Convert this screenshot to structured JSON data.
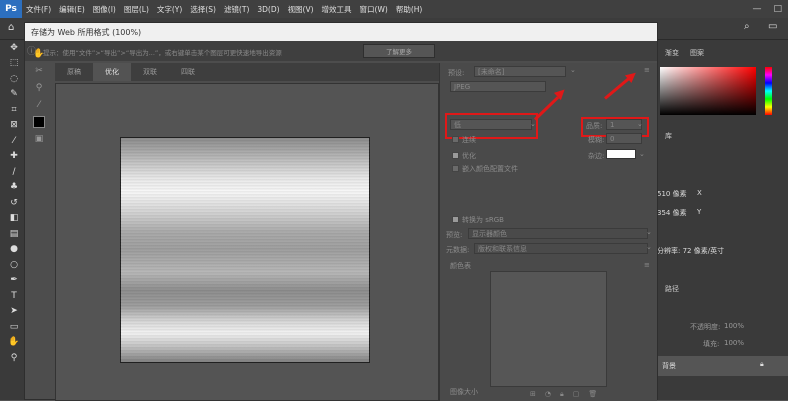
{
  "menubar": {
    "logo": "Ps",
    "items": [
      "文件(F)",
      "编辑(E)",
      "图像(I)",
      "图层(L)",
      "文字(Y)",
      "选择(S)",
      "滤镜(T)",
      "3D(D)",
      "视图(V)",
      "增效工具",
      "窗口(W)",
      "帮助(H)"
    ],
    "minimize": "—",
    "maximize": "□"
  },
  "dialog": {
    "title": "存储为 Web 所用格式 (100%)",
    "hint": "提示：使用“文件”>“导出”>“导出为...”，或右键单击某个图层可更快速地导出资源",
    "learn_more": "了解更多",
    "tabs": [
      "原稿",
      "优化",
      "双联",
      "四联"
    ],
    "active_tab": "优化"
  },
  "settings": {
    "preset_label": "预设:",
    "preset_value": "[未命名]",
    "format_value": "JPEG",
    "quality_level": "低",
    "quality_label": "品质:",
    "quality_value": "1",
    "progressive_label": "连续",
    "blur_label": "模糊:",
    "blur_value": "0",
    "optimized_label": "优化",
    "embed_profile_label": "嵌入颜色配置文件",
    "matte_label": "杂边:",
    "convert_srgb_label": "转换为 sRGB",
    "preview_label": "预览:",
    "preview_value": "显示器颜色",
    "metadata_label": "元数据:",
    "metadata_value": "版权和联系信息",
    "color_table_label": "颜色表",
    "image_size_label": "图像大小"
  },
  "right_panel": {
    "tab_swatches": "渐变",
    "tab_patterns": "图案",
    "library_label": "库",
    "width_value": "510 像素",
    "height_value": "354 像素",
    "resolution": "分辨率: 72 像素/英寸",
    "paths_tab": "路径",
    "opacity_label": "不透明度:",
    "opacity_value": "100%",
    "fill_label": "填充:",
    "fill_value": "100%",
    "layer_name": "背景"
  },
  "colors": {
    "annotation_red": "#e01818",
    "matte_color": "#ffffff"
  }
}
